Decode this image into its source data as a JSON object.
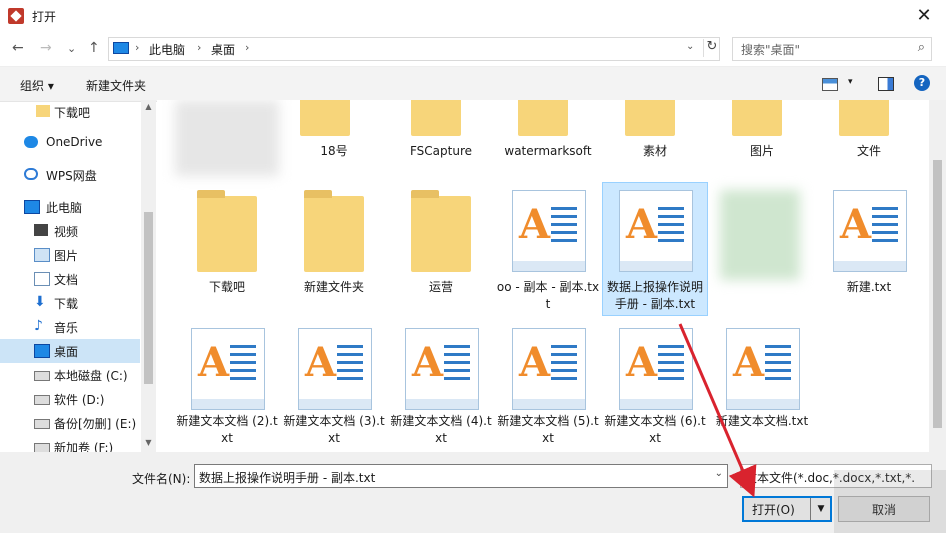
{
  "window": {
    "title": "打开",
    "close_symbol": "✕"
  },
  "nav": {
    "back": "←",
    "forward": "→",
    "recent": "⌄",
    "up": "↑"
  },
  "address": {
    "crumbs": [
      "此电脑",
      "桌面"
    ],
    "sep": "›",
    "dropdown": "⌄",
    "refresh": "↻"
  },
  "search": {
    "placeholder": "搜索\"桌面\"",
    "icon": "⌕"
  },
  "toolbar": {
    "organize": "组织 ▾",
    "new_folder": "新建文件夹",
    "view_dropdown": "▾",
    "help": "?"
  },
  "sidebar": {
    "items": [
      {
        "label": "下载吧",
        "icon": "folder-icon"
      },
      {
        "label": "OneDrive",
        "icon": "cloud-icon"
      },
      {
        "label": "WPS网盘",
        "icon": "cloud-icon"
      },
      {
        "label": "此电脑",
        "icon": "pc-icon"
      },
      {
        "label": "视频",
        "icon": "video-icon"
      },
      {
        "label": "图片",
        "icon": "picture-icon"
      },
      {
        "label": "文档",
        "icon": "document-icon"
      },
      {
        "label": "下载",
        "icon": "download-icon"
      },
      {
        "label": "音乐",
        "icon": "music-icon"
      },
      {
        "label": "桌面",
        "icon": "desktop-icon",
        "selected": true
      },
      {
        "label": "本地磁盘 (C:)",
        "icon": "drive-icon"
      },
      {
        "label": "软件 (D:)",
        "icon": "drive-icon"
      },
      {
        "label": "备份[勿删] (E:)",
        "icon": "drive-icon"
      },
      {
        "label": "新加卷 (F:)",
        "icon": "drive-icon"
      }
    ],
    "scroll_up": "▲",
    "scroll_down": "▼"
  },
  "files": {
    "row1": [
      "",
      "18号",
      "FSCapture",
      "watermarksoft",
      "素材",
      "图片",
      "文件"
    ],
    "row2": [
      "下载吧",
      "新建文件夹",
      "运营",
      "oo - 副本 - 副本.txt",
      "数据上报操作说明手册 - 副本.txt",
      "",
      "新建.txt"
    ],
    "row3": [
      "新建文本文档 (2).txt",
      "新建文本文档 (3).txt",
      "新建文本文档 (4).txt",
      "新建文本文档 (5).txt",
      "新建文本文档 (6).txt",
      "新建文本文档.txt"
    ]
  },
  "bottom": {
    "filename_label": "文件名(N):",
    "filename_value": "数据上报操作说明手册 - 副本.txt",
    "filetype_value": "文本文件(*.doc,*.docx,*.txt,*.p",
    "open": "打开(O)",
    "open_split": "▼",
    "cancel": "取消",
    "dropdown": "⌄"
  },
  "colors": {
    "selection": "#cce8ff",
    "accent": "#0078d7",
    "arrow": "#d9232e"
  }
}
